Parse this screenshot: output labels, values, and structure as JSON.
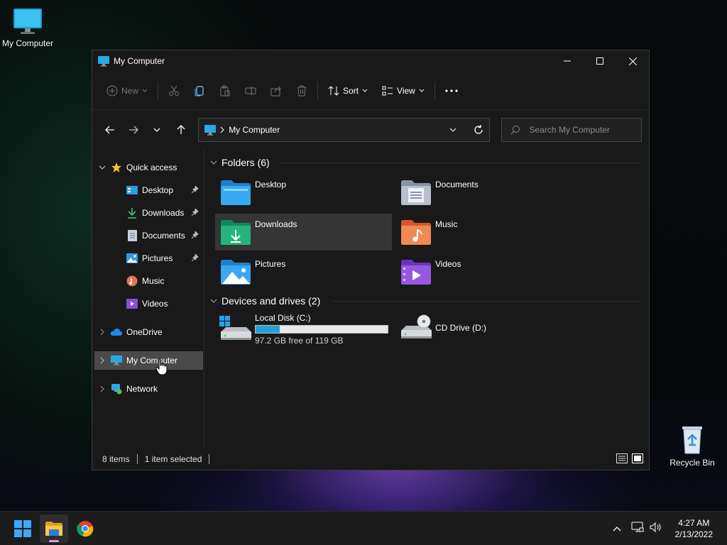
{
  "desktop": {
    "my_computer_label": "My Computer",
    "recycle_bin_label": "Recycle Bin"
  },
  "window": {
    "title": "My Computer",
    "commandbar": {
      "new_label": "New",
      "sort_label": "Sort",
      "view_label": "View"
    },
    "address": {
      "path": "My Computer"
    },
    "search": {
      "placeholder": "Search My Computer"
    },
    "sidebar": {
      "quick_access": "Quick access",
      "items": [
        {
          "label": "Desktop",
          "icon": "desktop-icon"
        },
        {
          "label": "Downloads",
          "icon": "downloads-icon"
        },
        {
          "label": "Documents",
          "icon": "documents-icon"
        },
        {
          "label": "Pictures",
          "icon": "pictures-icon"
        },
        {
          "label": "Music",
          "icon": "music-icon"
        },
        {
          "label": "Videos",
          "icon": "videos-icon"
        }
      ],
      "onedrive": "OneDrive",
      "my_computer": "My Computer",
      "network": "Network"
    },
    "folders": {
      "header": "Folders (6)",
      "items": [
        {
          "label": "Desktop"
        },
        {
          "label": "Documents"
        },
        {
          "label": "Downloads"
        },
        {
          "label": "Music"
        },
        {
          "label": "Pictures"
        },
        {
          "label": "Videos"
        }
      ]
    },
    "drives": {
      "header": "Devices and drives (2)",
      "local_disk": {
        "label": "Local Disk (C:)",
        "free_text": "97.2 GB free of 119 GB",
        "used_fraction": 0.183
      },
      "cd_drive": {
        "label": "CD Drive (D:)"
      }
    },
    "status": {
      "items": "8 items",
      "selected": "1 item selected"
    }
  },
  "taskbar": {
    "time": "4:27 AM",
    "date": "2/13/2022"
  },
  "colors": {
    "accent": "#26a0da",
    "window_bg": "#191919",
    "taskbar_bg": "#1c1c1c"
  }
}
